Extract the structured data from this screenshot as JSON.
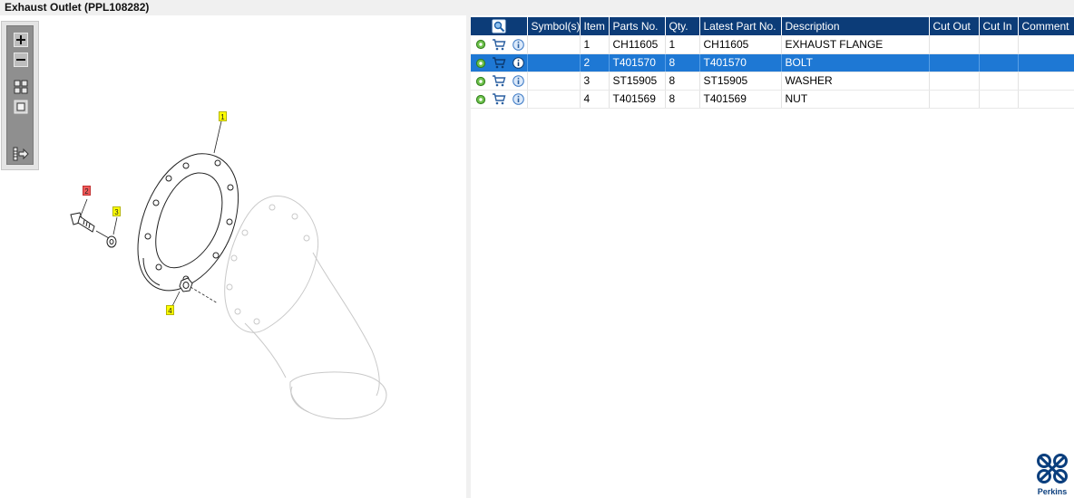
{
  "window": {
    "title": "Exhaust Outlet (PPL108282)"
  },
  "toolbar": {
    "buttons": [
      {
        "name": "zoom-in",
        "icon": "zoom-in-icon"
      },
      {
        "name": "zoom-out",
        "icon": "zoom-out-icon"
      },
      {
        "name": "fit-all",
        "icon": "grid-icon"
      },
      {
        "name": "actual-size",
        "icon": "square-icon"
      },
      {
        "name": "toggle-list",
        "icon": "list-arrow-icon"
      }
    ]
  },
  "drawing": {
    "callouts": [
      {
        "label": "1",
        "color": "yellow"
      },
      {
        "label": "2",
        "color": "red"
      },
      {
        "label": "3",
        "color": "yellow"
      },
      {
        "label": "4",
        "color": "yellow"
      }
    ]
  },
  "table": {
    "headers": [
      "",
      "Symbol(s)",
      "Item",
      "Parts No.",
      "Qty.",
      "Latest Part No.",
      "Description",
      "Cut Out",
      "Cut In",
      "Comment"
    ],
    "rows": [
      {
        "symbols": "",
        "item": "1",
        "part_no": "CH11605",
        "qty": "1",
        "latest": "CH11605",
        "desc": "EXHAUST FLANGE",
        "cut_out": "",
        "cut_in": "",
        "comment": ""
      },
      {
        "symbols": "",
        "item": "2",
        "part_no": "T401570",
        "qty": "8",
        "latest": "T401570",
        "desc": "BOLT",
        "cut_out": "",
        "cut_in": "",
        "comment": ""
      },
      {
        "symbols": "",
        "item": "3",
        "part_no": "ST15905",
        "qty": "8",
        "latest": "ST15905",
        "desc": "WASHER",
        "cut_out": "",
        "cut_in": "",
        "comment": ""
      },
      {
        "symbols": "",
        "item": "4",
        "part_no": "T401569",
        "qty": "8",
        "latest": "T401569",
        "desc": "NUT",
        "cut_out": "",
        "cut_in": "",
        "comment": ""
      }
    ],
    "selected_item": "2"
  },
  "colors": {
    "header_bg": "#0c3c78",
    "selection_bg": "#1e78d4",
    "callout_yellow": "#ffff00",
    "callout_red": "#f05b5b",
    "brand_blue": "#0a3e7d"
  },
  "brand": {
    "name": "Perkins"
  }
}
